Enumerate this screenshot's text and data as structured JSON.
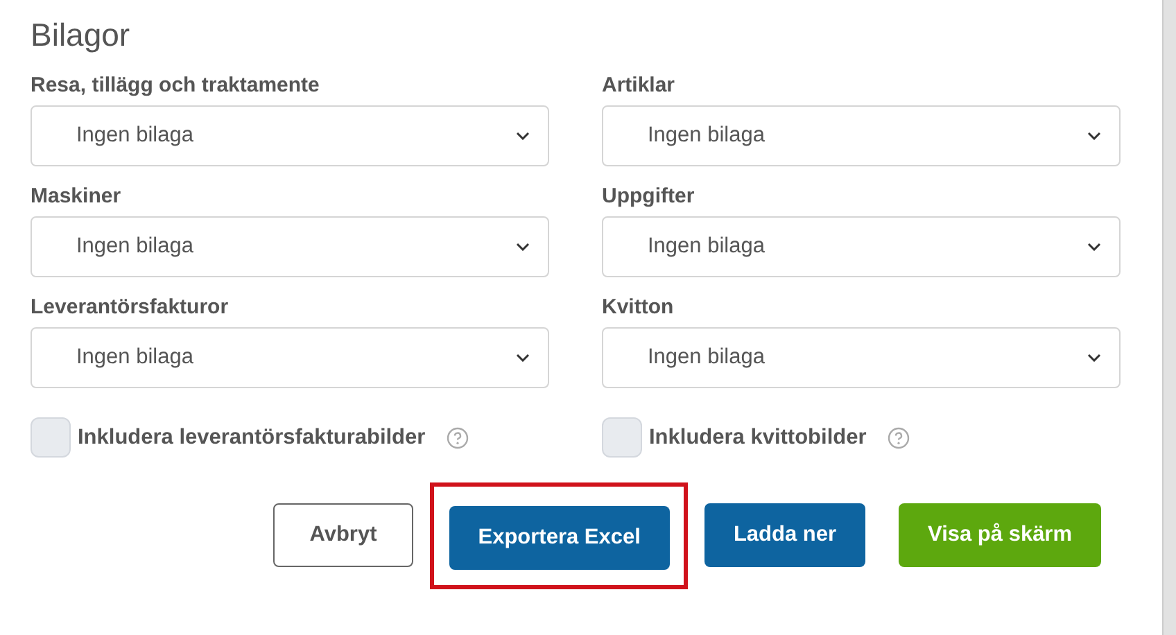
{
  "title": "Bilagor",
  "selects": [
    {
      "label": "Resa, tillägg och traktamente",
      "value": "Ingen bilaga"
    },
    {
      "label": "Artiklar",
      "value": "Ingen bilaga"
    },
    {
      "label": "Maskiner",
      "value": "Ingen bilaga"
    },
    {
      "label": "Uppgifter",
      "value": "Ingen bilaga"
    },
    {
      "label": "Leverantörsfakturor",
      "value": "Ingen bilaga"
    },
    {
      "label": "Kvitton",
      "value": "Ingen bilaga"
    }
  ],
  "checkboxes": [
    {
      "label": "Inkludera leverantörsfakturabilder",
      "checked": false
    },
    {
      "label": "Inkludera kvittobilder",
      "checked": false
    }
  ],
  "buttons": [
    {
      "label": "Avbryt",
      "kind": "outline",
      "highlighted": false
    },
    {
      "label": "Exportera Excel",
      "kind": "primary",
      "highlighted": true
    },
    {
      "label": "Ladda ner",
      "kind": "primary",
      "highlighted": false
    },
    {
      "label": "Visa på skärm",
      "kind": "success",
      "highlighted": false
    }
  ]
}
